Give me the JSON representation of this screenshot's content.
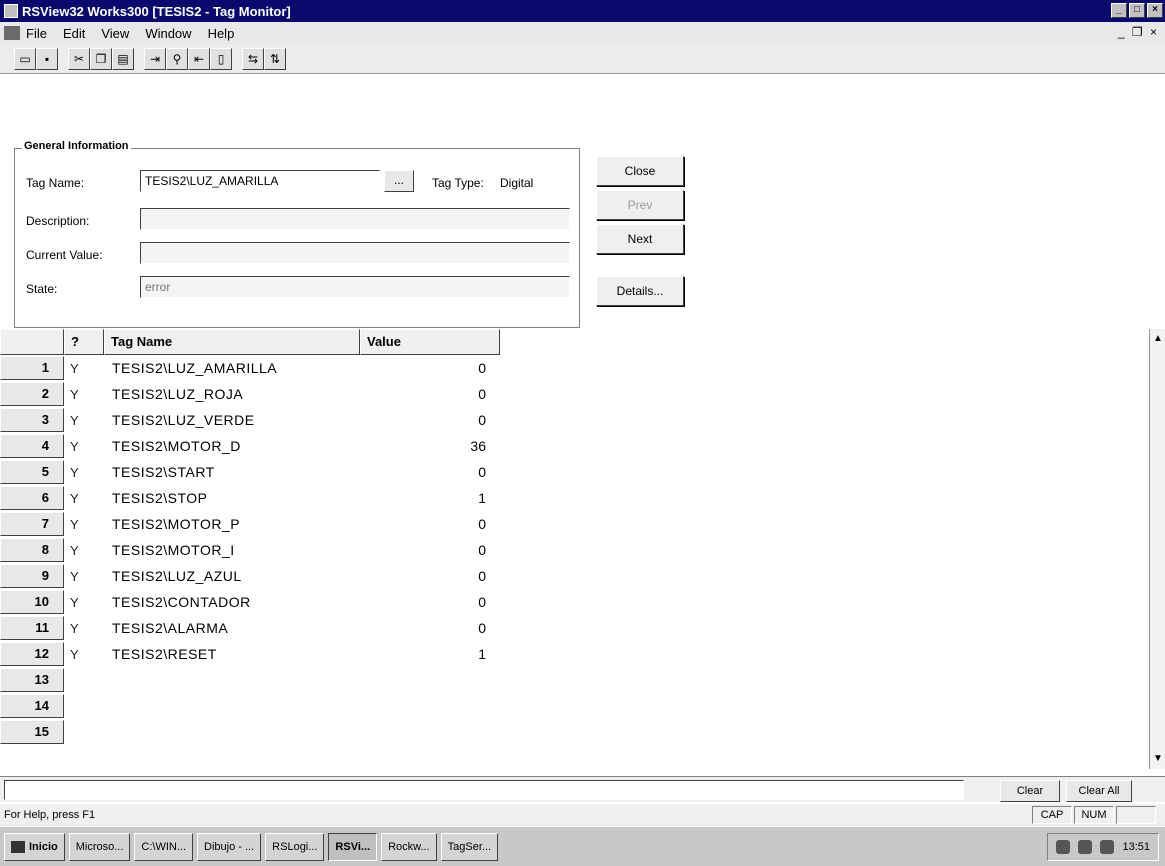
{
  "window": {
    "title": "RSView32 Works300   [TESIS2 - Tag Monitor]",
    "controls": [
      "_",
      "□",
      "×"
    ]
  },
  "menu": {
    "items": [
      "File",
      "Edit",
      "View",
      "Window",
      "Help"
    ],
    "mdi_controls": "_ ❐ ×"
  },
  "toolbar": {
    "icons": [
      "open-icon",
      "save-icon",
      "cut-icon",
      "copy-icon",
      "paste-icon",
      "tag-import-icon",
      "find-icon",
      "tag-export-icon",
      "delete-icon",
      "monitor-icon",
      "refresh-icon"
    ]
  },
  "general": {
    "legend": "General Information",
    "tag_name_label": "Tag Name:",
    "tag_name_value": "TESIS2\\LUZ_AMARILLA",
    "browse_label": "...",
    "tag_type_label": "Tag Type:",
    "tag_type_value": "Digital",
    "description_label": "Description:",
    "description_value": "",
    "current_value_label": "Current Value:",
    "current_value_value": "",
    "state_label": "State:",
    "state_value": "error"
  },
  "buttons": {
    "close": "Close",
    "prev": "Prev",
    "next": "Next",
    "details": "Details..."
  },
  "grid": {
    "headers": {
      "row": "",
      "q": "?",
      "tag_name": "Tag Name",
      "value": "Value"
    },
    "rows": [
      {
        "num": "1",
        "q": "Y",
        "name": "TESIS2\\LUZ_AMARILLA",
        "value": "0"
      },
      {
        "num": "2",
        "q": "Y",
        "name": "TESIS2\\LUZ_ROJA",
        "value": "0"
      },
      {
        "num": "3",
        "q": "Y",
        "name": "TESIS2\\LUZ_VERDE",
        "value": "0"
      },
      {
        "num": "4",
        "q": "Y",
        "name": "TESIS2\\MOTOR_D",
        "value": "36"
      },
      {
        "num": "5",
        "q": "Y",
        "name": "TESIS2\\START",
        "value": "0"
      },
      {
        "num": "6",
        "q": "Y",
        "name": "TESIS2\\STOP",
        "value": "1"
      },
      {
        "num": "7",
        "q": "Y",
        "name": "TESIS2\\MOTOR_P",
        "value": "0"
      },
      {
        "num": "8",
        "q": "Y",
        "name": "TESIS2\\MOTOR_I",
        "value": "0"
      },
      {
        "num": "9",
        "q": "Y",
        "name": "TESIS2\\LUZ_AZUL",
        "value": "0"
      },
      {
        "num": "10",
        "q": "Y",
        "name": "TESIS2\\CONTADOR",
        "value": "0"
      },
      {
        "num": "11",
        "q": "Y",
        "name": "TESIS2\\ALARMA",
        "value": "0"
      },
      {
        "num": "12",
        "q": "Y",
        "name": "TESIS2\\RESET",
        "value": "1"
      },
      {
        "num": "13",
        "q": "",
        "name": "",
        "value": ""
      },
      {
        "num": "14",
        "q": "",
        "name": "",
        "value": ""
      },
      {
        "num": "15",
        "q": "",
        "name": "",
        "value": ""
      }
    ]
  },
  "command": {
    "clear": "Clear",
    "clear_all": "Clear All"
  },
  "status": {
    "help": "For Help, press F1",
    "cap": "CAP",
    "num": "NUM"
  },
  "taskbar": {
    "start": "Inicio",
    "tasks": [
      "Microso...",
      "C:\\WIN...",
      "Dibujo - ...",
      "RSLogi...",
      "RSVi...",
      "Rockw...",
      "TagSer..."
    ],
    "active_task": 4,
    "clock": "13:51"
  }
}
